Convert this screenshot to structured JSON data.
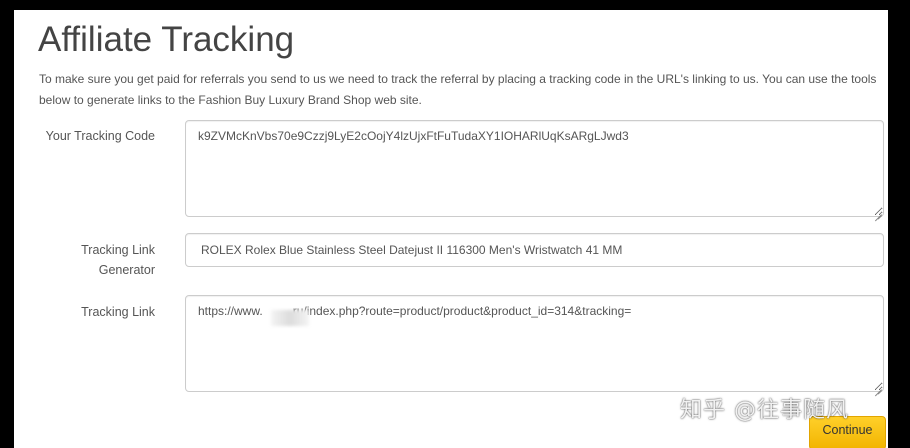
{
  "page": {
    "title": "Affiliate Tracking",
    "intro": "To make sure you get paid for referrals you send to us we need to track the referral by placing a tracking code in the URL's linking to us. You can use the tools below to generate links to the Fashion Buy Luxury Brand Shop web site."
  },
  "form": {
    "tracking_code": {
      "label": "Your Tracking Code",
      "value": "k9ZVMcKnVbs70e9Czzj9LyE2cOojY4lzUjxFtFuTudaXY1IOHARlUqKsARgLJwd3"
    },
    "link_generator": {
      "label_line1": "Tracking Link",
      "label_line2": "Generator",
      "value": "ROLEX Rolex Blue Stainless Steel Datejust II 116300 Men's Wristwatch 41 MM"
    },
    "tracking_link": {
      "label": "Tracking Link",
      "value": "https://www.        .ru/index.php?route=product/product&product_id=314&tracking="
    }
  },
  "actions": {
    "continue_label": "Continue"
  },
  "watermark": "知乎 @往事随风",
  "colors": {
    "accent_button": "#f5b800",
    "text": "#555555",
    "title": "#444444",
    "border": "#cccccc"
  }
}
